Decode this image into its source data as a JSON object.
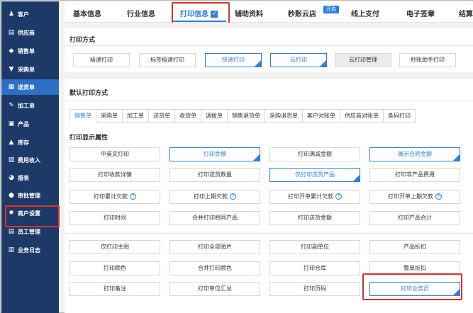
{
  "sidebar": {
    "items": [
      {
        "label": "客户",
        "icon": "users-icon",
        "glyph": "♟"
      },
      {
        "label": "供应商",
        "icon": "supplier-icon",
        "glyph": "▤"
      },
      {
        "label": "销售单",
        "icon": "tag-icon",
        "glyph": "◆"
      },
      {
        "label": "采购单",
        "icon": "cart-icon",
        "glyph": "▼"
      },
      {
        "label": "送货单",
        "icon": "document-icon",
        "glyph": "▦"
      },
      {
        "label": "加工单",
        "icon": "tool-icon",
        "glyph": "✎"
      },
      {
        "label": "产品",
        "icon": "box-icon",
        "glyph": "▣"
      },
      {
        "label": "库存",
        "icon": "warehouse-icon",
        "glyph": "▲"
      },
      {
        "label": "费用收入",
        "icon": "money-icon",
        "glyph": "▧"
      },
      {
        "label": "报表",
        "icon": "pie-chart-icon",
        "glyph": "◕"
      },
      {
        "label": "审批管理",
        "icon": "user-icon",
        "glyph": "●"
      },
      {
        "label": "商户设置",
        "icon": "gear-icon",
        "glyph": "✹"
      },
      {
        "label": "员工管理",
        "icon": "staff-icon",
        "glyph": "▤"
      },
      {
        "label": "业务日志",
        "icon": "log-icon",
        "glyph": "▥"
      }
    ],
    "active_index": 4,
    "highlighted_index": 11
  },
  "tabs": [
    {
      "label": "基本信息"
    },
    {
      "label": "行业信息"
    },
    {
      "label": "打印信息",
      "active": true
    },
    {
      "label": "辅助资料"
    },
    {
      "label": "秒账云店"
    },
    {
      "label": "线上支付"
    },
    {
      "label": "电子签章"
    },
    {
      "label": "结算"
    }
  ],
  "open_badge": "开启",
  "print_mode": {
    "title": "打印方式",
    "buttons": [
      {
        "label": "极速打印",
        "selected": false
      },
      {
        "label": "标签极速打印",
        "selected": false
      },
      {
        "label": "快速打印",
        "selected": true
      },
      {
        "label": "云打印",
        "selected": true
      },
      {
        "label": "云打印管理",
        "selected": false,
        "grey": true
      },
      {
        "label": "秒账助手打印",
        "selected": false
      }
    ]
  },
  "default_print": {
    "title": "默认打印方式",
    "subtabs": [
      "销售单",
      "采购单",
      "加工单",
      "送货单",
      "收货单",
      "调拨单",
      "销售退货单",
      "采购退货单",
      "客户对账单",
      "供应商对账单",
      "条码打印"
    ],
    "active_subtab": 3,
    "attr_title": "打印显示属性",
    "grid_rows": [
      [
        {
          "label": "中英文打印"
        },
        {
          "label": "打印金额",
          "selected": true
        },
        {
          "label": "打印满减金额"
        },
        {
          "label": "展示合同金额",
          "selected": true
        }
      ],
      [
        {
          "label": "打印收款详情"
        },
        {
          "label": "打印送货数量"
        },
        {
          "label": "仅打印送货产品",
          "selected": true
        },
        {
          "label": "打印非产品费用"
        }
      ],
      [
        {
          "label": "打印累计欠款",
          "help": true
        },
        {
          "label": "打印上期欠款",
          "help": true
        },
        {
          "label": "打印开单累计欠款",
          "help": true
        },
        {
          "label": "打印开单上期欠款",
          "help": true
        }
      ],
      [
        {
          "label": "打印时间"
        },
        {
          "label": "合并打印相同产品"
        },
        {
          "label": "打印送货金额"
        },
        {
          "label": "打印产品合计"
        }
      ]
    ],
    "grid_rows_2": [
      [
        {
          "label": "仅打印主图"
        },
        {
          "label": "打印全部图片"
        },
        {
          "label": "打印副单位"
        },
        {
          "label": "产品折扣"
        }
      ],
      [
        {
          "label": "打印颜色"
        },
        {
          "label": "合并打印颜色"
        },
        {
          "label": "打印仓库"
        },
        {
          "label": "整单折扣"
        }
      ],
      [
        {
          "label": "打印备注"
        },
        {
          "label": "打印单位汇总"
        },
        {
          "label": "打印页码"
        },
        {
          "label": "打印业务员",
          "selected": true
        }
      ]
    ]
  },
  "colors": {
    "sidebar_bg": "#1b3a67",
    "sidebar_active": "#2d6fc4",
    "accent": "#2d7fe0",
    "highlight_box": "#e0302a"
  }
}
